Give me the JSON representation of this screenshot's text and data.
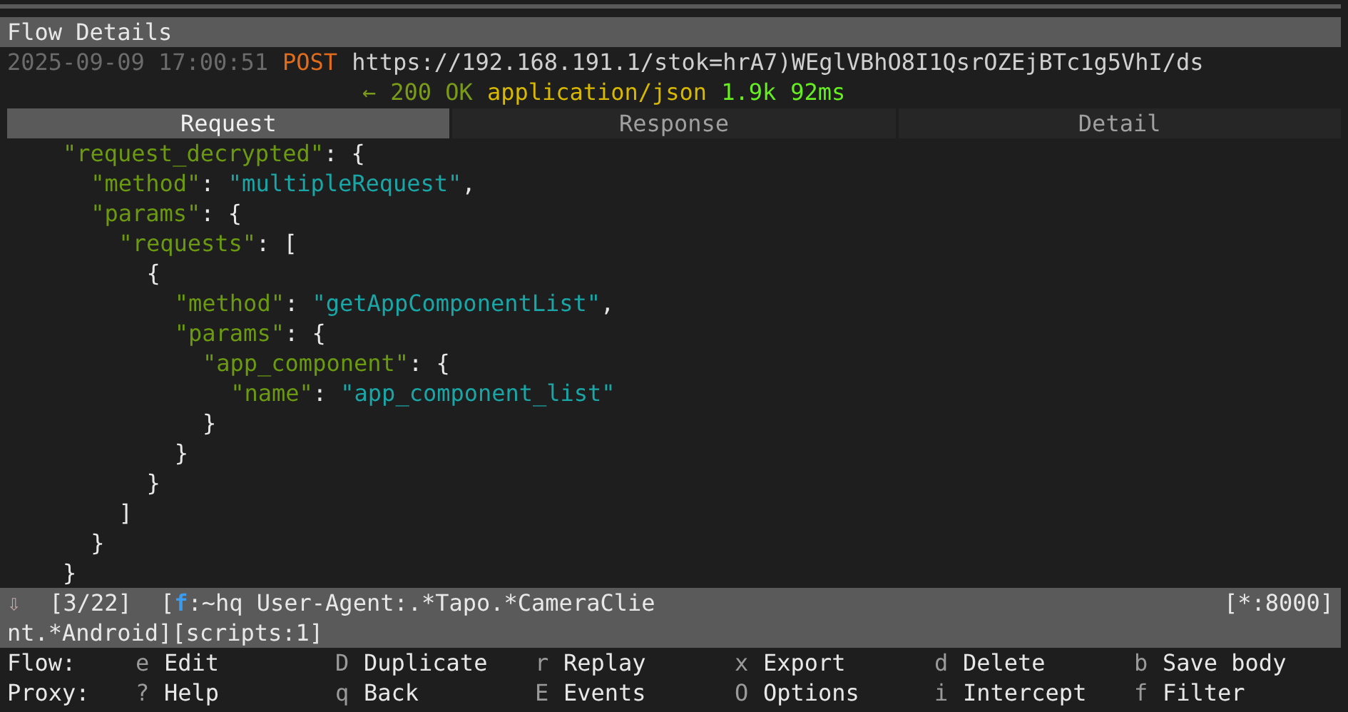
{
  "title": "Flow Details",
  "flow": {
    "timestamp": "2025-09-09 17:00:51",
    "method": "POST",
    "url": "https://192.168.191.1/stok=hrA7)WEglVBhO8I1QsrOZEjBTc1g5VhI/ds"
  },
  "response": {
    "arrow": "←",
    "status": "200 OK",
    "content_type": "application/json",
    "size": "1.9k",
    "time": "92ms"
  },
  "tabs": [
    {
      "label": "Request",
      "selected": true
    },
    {
      "label": "Response",
      "selected": false
    },
    {
      "label": "Detail",
      "selected": false
    }
  ],
  "body": [
    {
      "tokens": [
        {
          "kind": "key",
          "text": "\"request_decrypted\""
        },
        {
          "kind": "punct",
          "text": ": {"
        }
      ],
      "children": [
        {
          "tokens": [
            {
              "kind": "key",
              "text": "\"method\""
            },
            {
              "kind": "punct",
              "text": ": "
            },
            {
              "kind": "string",
              "text": "\"multipleRequest\""
            },
            {
              "kind": "punct",
              "text": ","
            }
          ]
        },
        {
          "tokens": [
            {
              "kind": "key",
              "text": "\"params\""
            },
            {
              "kind": "punct",
              "text": ": {"
            }
          ],
          "children": [
            {
              "tokens": [
                {
                  "kind": "key",
                  "text": "\"requests\""
                },
                {
                  "kind": "punct",
                  "text": ": ["
                }
              ],
              "children": [
                {
                  "tokens": [
                    {
                      "kind": "punct",
                      "text": "{"
                    }
                  ],
                  "children": [
                    {
                      "tokens": [
                        {
                          "kind": "key",
                          "text": "\"method\""
                        },
                        {
                          "kind": "punct",
                          "text": ": "
                        },
                        {
                          "kind": "string",
                          "text": "\"getAppComponentList\""
                        },
                        {
                          "kind": "punct",
                          "text": ","
                        }
                      ]
                    },
                    {
                      "tokens": [
                        {
                          "kind": "key",
                          "text": "\"params\""
                        },
                        {
                          "kind": "punct",
                          "text": ": {"
                        }
                      ],
                      "children": [
                        {
                          "tokens": [
                            {
                              "kind": "key",
                              "text": "\"app_component\""
                            },
                            {
                              "kind": "punct",
                              "text": ": {"
                            }
                          ],
                          "children": [
                            {
                              "tokens": [
                                {
                                  "kind": "key",
                                  "text": "\"name\""
                                },
                                {
                                  "kind": "punct",
                                  "text": ": "
                                },
                                {
                                  "kind": "string",
                                  "text": "\"app_component_list\""
                                }
                              ]
                            }
                          ]
                        },
                        {
                          "tokens": [
                            {
                              "kind": "punct",
                              "text": "}"
                            }
                          ]
                        }
                      ]
                    },
                    {
                      "tokens": [
                        {
                          "kind": "punct",
                          "text": "}"
                        }
                      ]
                    }
                  ]
                },
                {
                  "tokens": [
                    {
                      "kind": "punct",
                      "text": "}"
                    }
                  ]
                }
              ]
            },
            {
              "tokens": [
                {
                  "kind": "punct",
                  "text": "]"
                }
              ]
            }
          ]
        },
        {
          "tokens": [
            {
              "kind": "punct",
              "text": "}"
            }
          ]
        }
      ]
    },
    {
      "tokens": [
        {
          "kind": "punct",
          "text": "}"
        }
      ]
    }
  ],
  "status_bar": {
    "arrow": "⇩",
    "position": "[3/22]",
    "filter_open": "[",
    "filter_flag": "f",
    "filter_line1": ":~hq User-Agent:.*Tapo.*CameraClie",
    "filter_line2": "nt.*Android]",
    "scripts": "[scripts:1]",
    "listen": "[*:8000]"
  },
  "keybindings": [
    {
      "label": "Flow:",
      "items": [
        {
          "key": "e",
          "action": "Edit"
        },
        {
          "key": "D",
          "action": "Duplicate"
        },
        {
          "key": "r",
          "action": "Replay"
        },
        {
          "key": "x",
          "action": "Export"
        },
        {
          "key": "d",
          "action": "Delete"
        },
        {
          "key": "b",
          "action": "Save body"
        }
      ]
    },
    {
      "label": "Proxy:",
      "items": [
        {
          "key": "?",
          "action": "Help"
        },
        {
          "key": "q",
          "action": "Back"
        },
        {
          "key": "E",
          "action": "Events"
        },
        {
          "key": "O",
          "action": "Options"
        },
        {
          "key": "i",
          "action": "Intercept"
        },
        {
          "key": "f",
          "action": "Filter"
        }
      ]
    }
  ]
}
